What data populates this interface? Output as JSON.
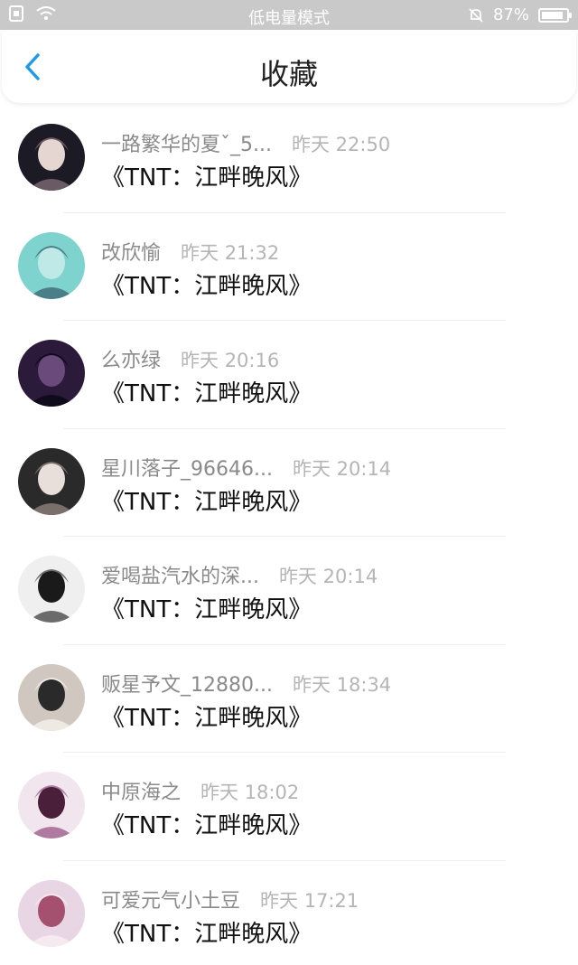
{
  "status_bar": {
    "mode": "低电量模式",
    "battery_text": "87%",
    "battery_level": 0.87
  },
  "header": {
    "title": "收藏"
  },
  "items": [
    {
      "username": "一路繁华的夏ˇ_5...",
      "time": "昨天 22:50",
      "title": "《TNT：江畔晚风》",
      "avatar_colors": [
        "#1c1a24",
        "#e6d6d2",
        "#6a5a63"
      ]
    },
    {
      "username": "改欣愉",
      "time": "昨天 21:32",
      "title": "《TNT：江畔晚风》",
      "avatar_colors": [
        "#7fd3cf",
        "#bfe9e6",
        "#4a7f8a"
      ]
    },
    {
      "username": "么亦绿",
      "time": "昨天 20:16",
      "title": "《TNT：江畔晚风》",
      "avatar_colors": [
        "#2b1a3a",
        "#6a4a7a",
        "#0f0a1c"
      ]
    },
    {
      "username": "星川落子_96646...",
      "time": "昨天 20:14",
      "title": "《TNT：江畔晚风》",
      "avatar_colors": [
        "#2a2a2a",
        "#e8dfda",
        "#7a6f6b"
      ]
    },
    {
      "username": "爱喝盐汽水的深...",
      "time": "昨天 20:14",
      "title": "《TNT：江畔晚风》",
      "avatar_colors": [
        "#efefef",
        "#1a1a1a",
        "#6b6b6b"
      ]
    },
    {
      "username": "贩星予文_12880...",
      "time": "昨天 18:34",
      "title": "《TNT：江畔晚风》",
      "avatar_colors": [
        "#cfc7c0",
        "#2a2a2a",
        "#efe9e3"
      ]
    },
    {
      "username": "中原海之",
      "time": "昨天 18:02",
      "title": "《TNT：江畔晚风》",
      "avatar_colors": [
        "#f2e6ee",
        "#4a1f3a",
        "#b07aa0"
      ]
    },
    {
      "username": "可爱元气小土豆",
      "time": "昨天 17:21",
      "title": "《TNT：江畔晚风》",
      "avatar_colors": [
        "#e9d6e4",
        "#a5506e",
        "#f5eaf0"
      ]
    }
  ]
}
